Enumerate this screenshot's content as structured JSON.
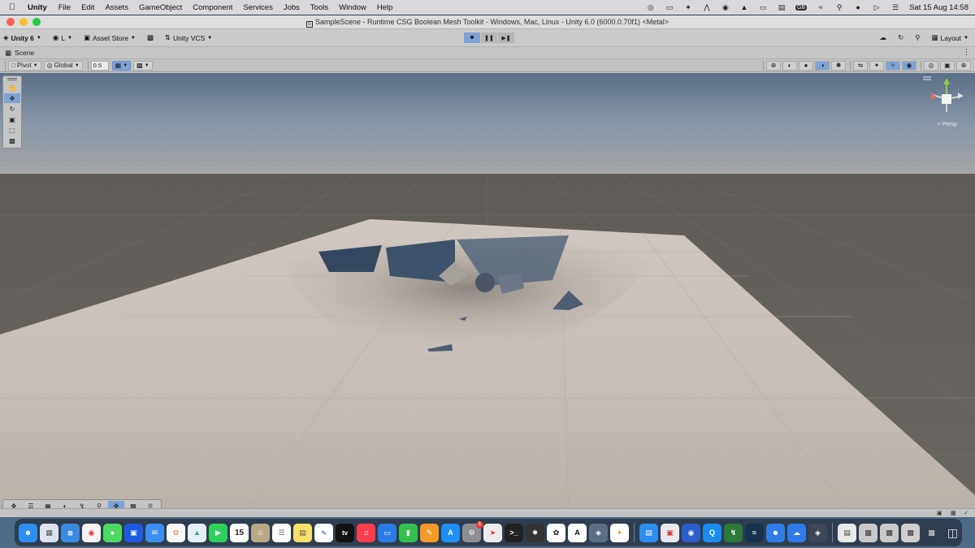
{
  "menubar": {
    "apple_icon": "apple-logo",
    "app_name": "Unity",
    "items": [
      "File",
      "Edit",
      "Assets",
      "GameObject",
      "Component",
      "Services",
      "Jobs",
      "Tools",
      "Window",
      "Help"
    ],
    "status_icons": [
      "radar-icon",
      "cast-icon",
      "sparkle-icon",
      "airdrop-icon",
      "record-icon",
      "signal-icon",
      "screen-icon",
      "keyboard-icon",
      "wifi-icon",
      "search-icon",
      "account-icon",
      "play-icon",
      "control-center-icon"
    ],
    "keyboard_label": "GB",
    "clock": "Sat 15 Aug  14:58"
  },
  "window": {
    "title": "SampleScene - Runtime CSG Boolean Mesh Toolkit - Windows, Mac, Linux - Unity 6.0 (6000.0.70f1) <Metal>",
    "title_icon": "unity-file-icon"
  },
  "toolbar": {
    "unity_label": "Unity 6",
    "account_label": "L",
    "asset_store_label": "Asset Store",
    "vcs_label": "Unity VCS",
    "layout_label": "Layout"
  },
  "scene_tab": {
    "label": "Scene",
    "icon": "grid-icon"
  },
  "scene_bar": {
    "pivot_label": "Pivot",
    "global_label": "Global",
    "snap_value": "0.5"
  },
  "gizmo": {
    "persp_label": "< Persp"
  },
  "tools": [
    "hand-icon",
    "move-icon",
    "rotate-icon",
    "scale-icon",
    "rect-icon",
    "transform-icon"
  ],
  "overlay_tools": [
    "move-icon",
    "sliders-icon",
    "grid-icon",
    "sphere-icon",
    "bolt-icon",
    "search-icon",
    "move-icon",
    "paint-icon",
    "compass-icon"
  ],
  "dock": {
    "calendar_day": "15",
    "appletv_label": "tv",
    "settings_badge": "1"
  }
}
